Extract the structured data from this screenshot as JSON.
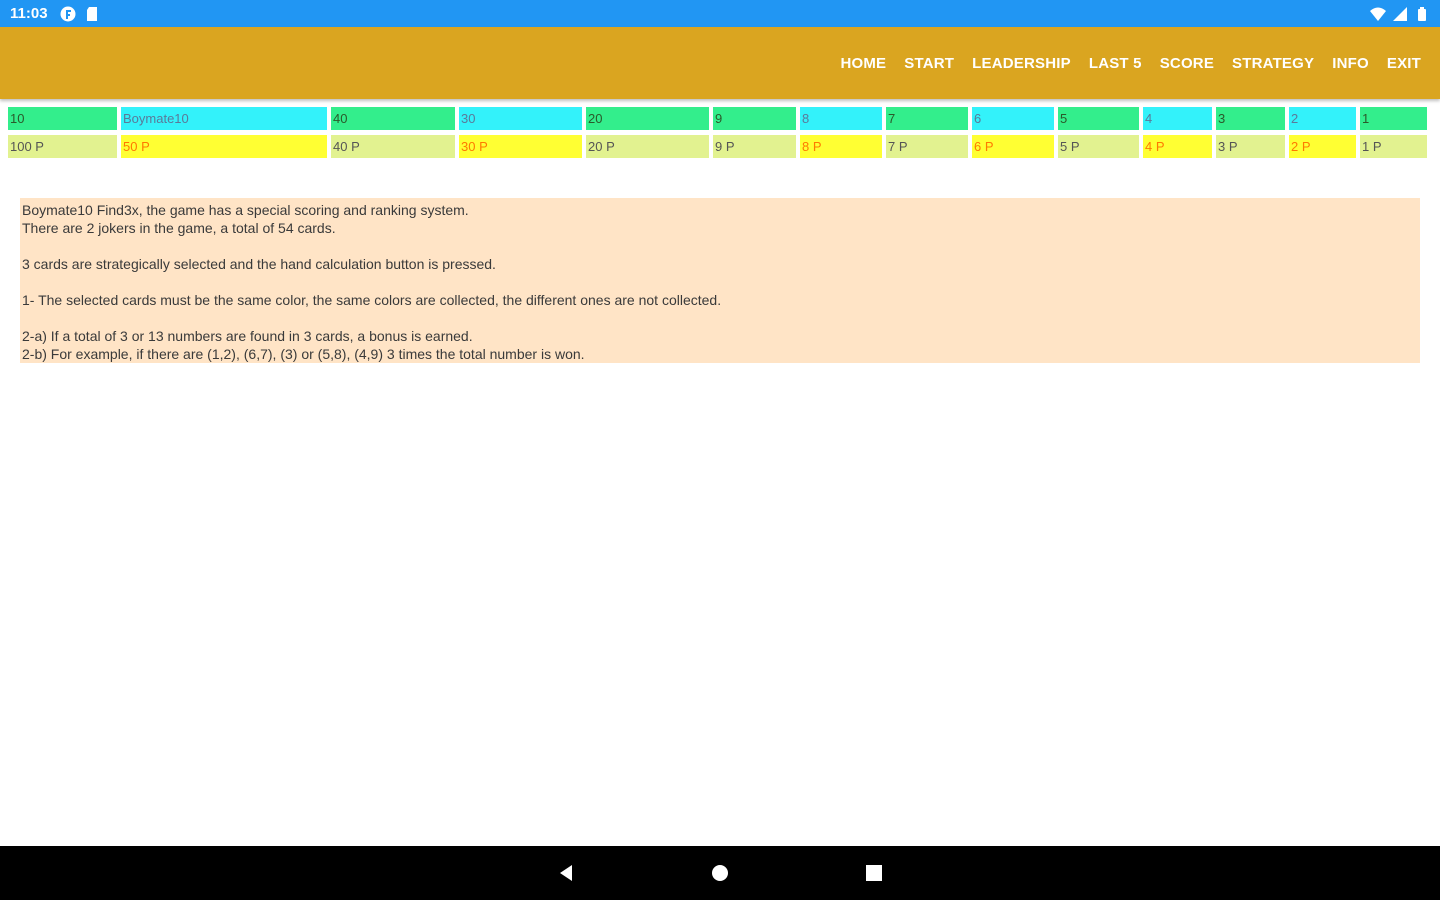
{
  "status_bar": {
    "time": "11:03",
    "icons": [
      "app-notification-icon",
      "sd-card-icon",
      "wifi-icon",
      "signal-icon",
      "battery-icon"
    ]
  },
  "nav": {
    "items": [
      "HOME",
      "START",
      "LEADERSHIP",
      "LAST 5",
      "SCORE",
      "STRATEGY",
      "INFO",
      "EXIT"
    ]
  },
  "ranking": {
    "names": [
      "10",
      "Boymate10",
      "40",
      "30",
      "20",
      "9",
      "8",
      "7",
      "6",
      "5",
      "4",
      "3",
      "2",
      "1"
    ],
    "points": [
      "100 P",
      "50 P",
      "40 P",
      "30 P",
      "20 P",
      "9 P",
      "8 P",
      "7 P",
      "6 P",
      "5 P",
      "4 P",
      "3 P",
      "2 P",
      "1 P"
    ]
  },
  "info": {
    "lines": [
      "Boymate10 Find3x, the game has a special scoring and ranking system.",
      "There are 2 jokers in the game, a total of 54 cards.",
      "",
      "3 cards are strategically selected and the hand calculation button is pressed.",
      "",
      "1- The selected cards must be the same color, the same colors are collected, the different ones are not collected.",
      "",
      "2-a) If a total of 3 or 13 numbers are found in 3 cards, a bonus is earned.",
      "2-b) For example, if there are (1,2), (6,7), (3) or (5,8), (4,9) 3 times the total number is won."
    ]
  },
  "colors": {
    "status_bar": "#2196f3",
    "app_bar": "#daa520",
    "cell_green": "#33ee8c",
    "cell_cyan": "#33f2fa",
    "cell_lime": "#e2f290",
    "cell_yellow": "#ffff33",
    "info_bg": "#ffe4c6"
  }
}
